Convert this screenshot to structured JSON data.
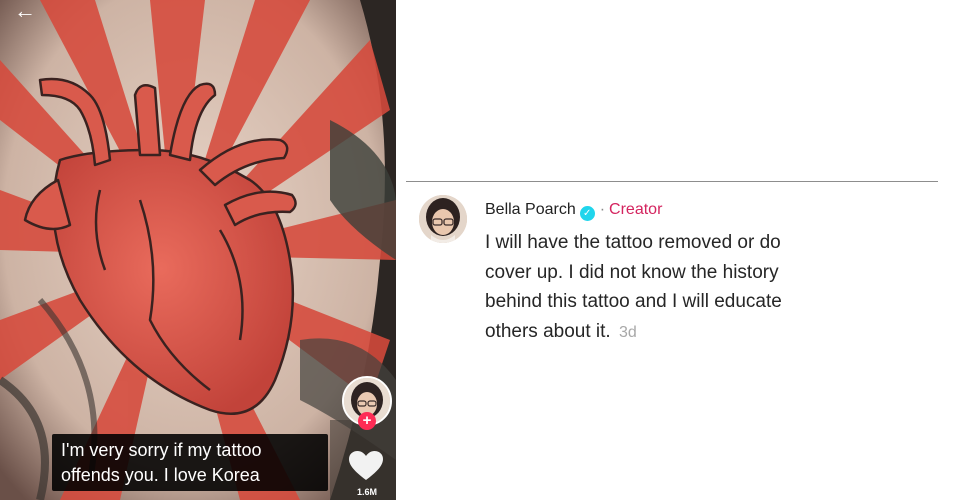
{
  "video": {
    "caption_lines": [
      "I'm very sorry if my tattoo",
      "offends you. I love Korea"
    ],
    "like_count": "1.6M",
    "icons": {
      "back": "back-arrow-icon",
      "follow": "plus-icon",
      "like": "heart-icon"
    },
    "colors": {
      "follow_badge": "#fe2c55",
      "caption_bg": "#000000"
    }
  },
  "comment": {
    "username": "Bella Poarch",
    "badge": "verified-icon",
    "separator": "·",
    "role": "Creator",
    "lines": [
      "I will have the tattoo removed or do",
      "cover up. I did not know the history",
      "behind this tattoo and I will educate",
      "others about it."
    ],
    "time": "3d",
    "colors": {
      "role": "#d4245f",
      "verified": "#20d5ec",
      "time": "#a8a8a8"
    }
  }
}
